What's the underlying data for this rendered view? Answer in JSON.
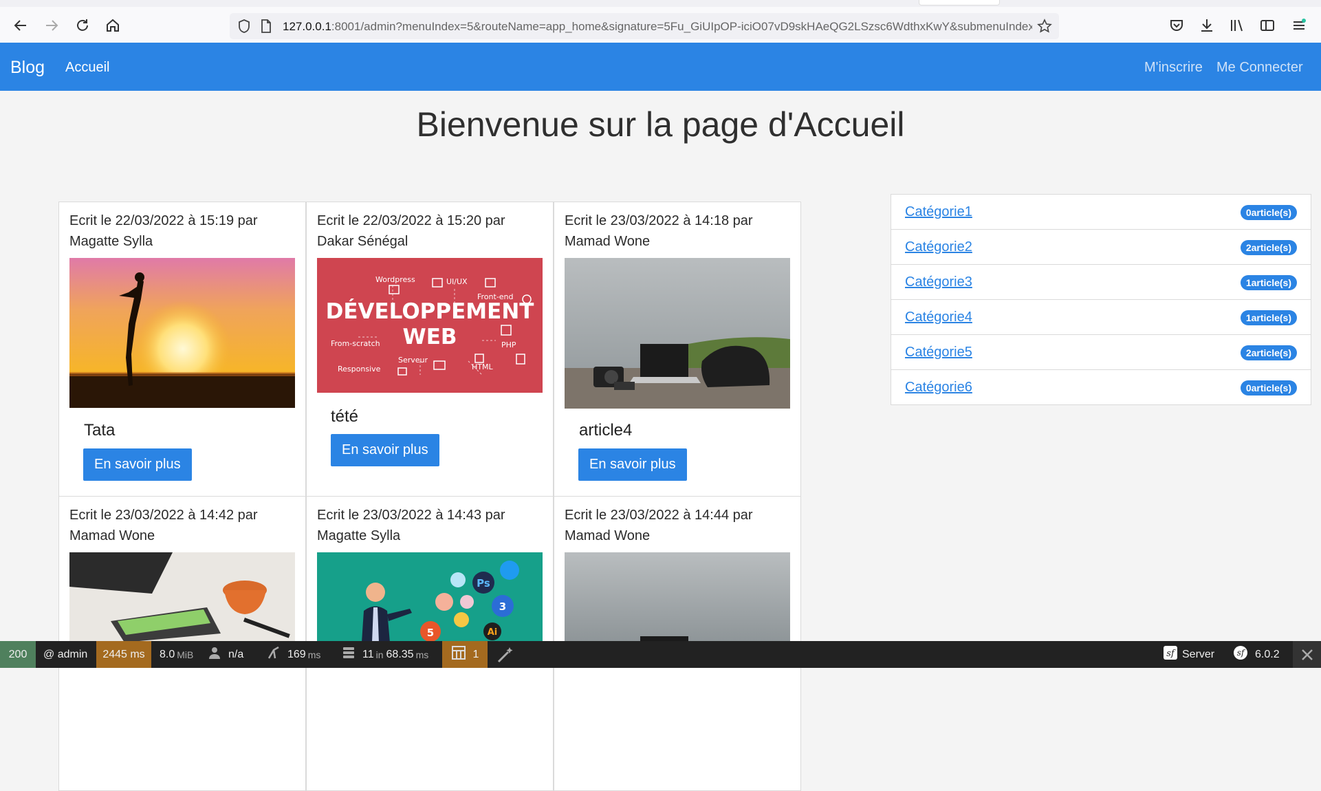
{
  "browser": {
    "url_host": "127.0.0.1",
    "url_rest": ":8001/admin?menuIndex=5&routeName=app_home&signature=5Fu_GiUIpOP-iciO07vD9skHAeQG2LSzsc6WdthxKwY&submenuIndex"
  },
  "navbar": {
    "brand": "Blog",
    "home_link": "Accueil",
    "register_link": "M'inscrire",
    "login_link": "Me Connecter"
  },
  "page": {
    "title": "Bienvenue sur la page d'Accueil"
  },
  "articles": [
    {
      "meta_line1": "Ecrit le 22/03/2022 à 15:19 par",
      "meta_line2": "Magatte Sylla",
      "title": "Tata",
      "button": "En savoir plus",
      "image": "sunset-silhouette"
    },
    {
      "meta_line1": "Ecrit le 22/03/2022 à 15:20 par",
      "meta_line2": "Dakar Sénégal",
      "title": "tété",
      "button": "En savoir plus",
      "image": "developpement-web",
      "image_text": {
        "line1": "DÉVELOPPEMENT",
        "line2": "WEB",
        "tags": [
          "Wordpress",
          "UI/UX",
          "Front-end",
          "From-scratch",
          "PHP",
          "Serveur",
          "Responsive",
          "HTML"
        ]
      }
    },
    {
      "meta_line1": "Ecrit le 23/03/2022 à 14:18 par",
      "meta_line2": "Mamad Wone",
      "title": "article4",
      "button": "En savoir plus",
      "image": "laptop-by-sea"
    },
    {
      "meta_line1": "Ecrit le 23/03/2022 à 14:42 par",
      "meta_line2": "Mamad Wone",
      "image": "desk-coffee-phone"
    },
    {
      "meta_line1": "Ecrit le 23/03/2022 à 14:43 par",
      "meta_line2": "Magatte Sylla",
      "image": "designer-icons",
      "image_text": {
        "ps": "Ps",
        "css": "3",
        "html": "5",
        "ai": "Ai"
      }
    },
    {
      "meta_line1": "Ecrit le 23/03/2022 à 14:44 par",
      "meta_line2": "Mamad Wone",
      "image": "laptop-by-sea"
    }
  ],
  "categories": [
    {
      "name": "Catégorie1",
      "count": "0article(s)"
    },
    {
      "name": "Catégorie2",
      "count": "2article(s)"
    },
    {
      "name": "Catégorie3",
      "count": "1article(s)"
    },
    {
      "name": "Catégorie4",
      "count": "1article(s)"
    },
    {
      "name": "Catégorie5",
      "count": "2article(s)"
    },
    {
      "name": "Catégorie6",
      "count": "0article(s)"
    }
  ],
  "debug_toolbar": {
    "status": "200",
    "user": "@ admin",
    "time": "2445 ms",
    "memory_value": "8.0",
    "memory_unit": "MiB",
    "auth": "n/a",
    "queries_time_value": "169",
    "queries_time_unit": "ms",
    "db_count": "11",
    "db_in": "in",
    "db_time_value": "68.35",
    "db_time_unit": "ms",
    "twig_count": "1",
    "server": "Server",
    "version": "6.0.2"
  },
  "colors": {
    "primary": "#2b84e4",
    "toolbar_bg": "#222222",
    "status_ok": "#4f805d",
    "toolbar_warn": "#a46a1f"
  }
}
